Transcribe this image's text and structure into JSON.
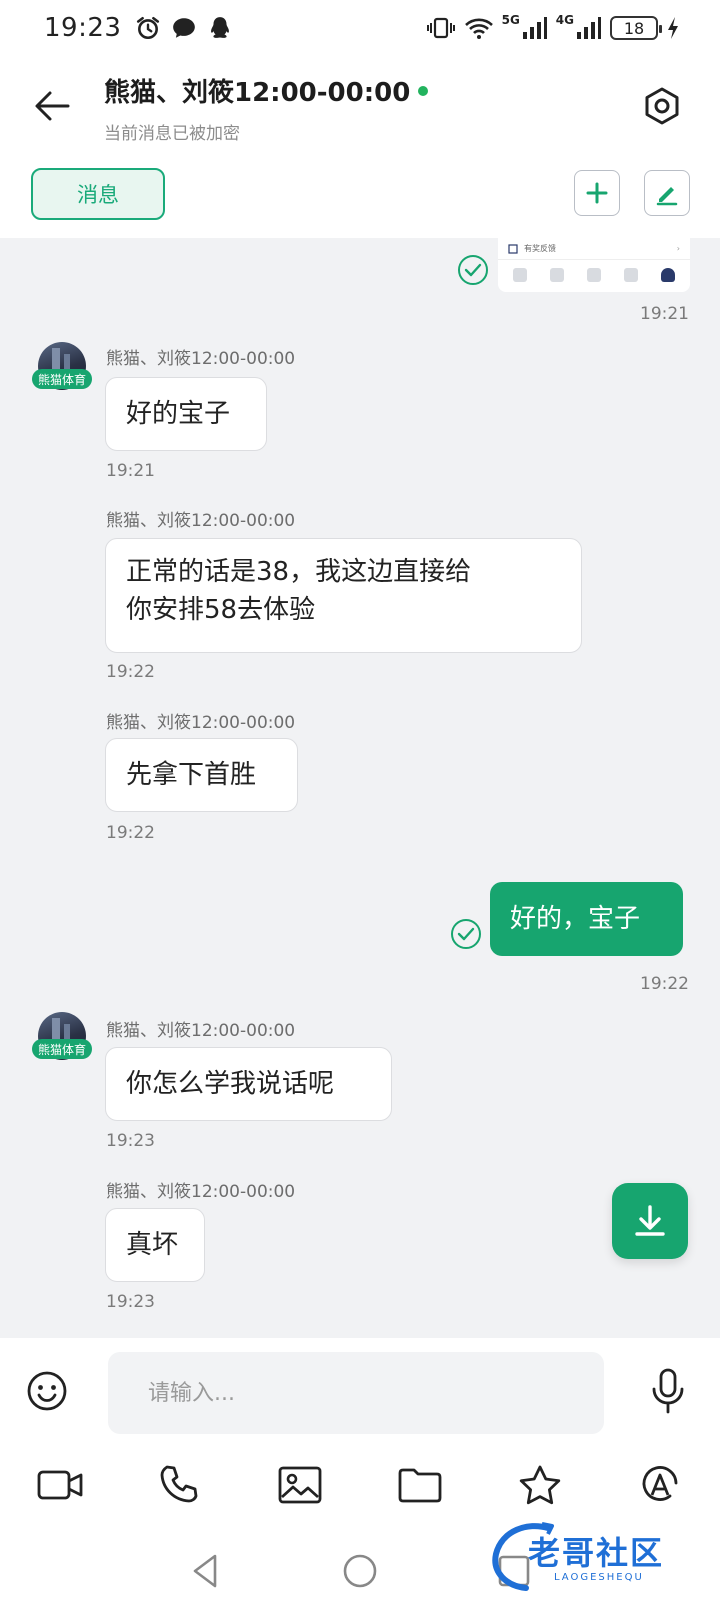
{
  "status_bar": {
    "time": "19:23",
    "network_1": "5G",
    "network_2": "4G",
    "battery": "18"
  },
  "header": {
    "title": "熊猫、刘筱12:00-00:00",
    "subtitle": "当前消息已被加密"
  },
  "tabs": {
    "messages_label": "消息"
  },
  "screenshot_preview": {
    "row_label": "有奖反馈"
  },
  "messages": [
    {
      "side": "self",
      "kind": "image",
      "time": "19:21"
    },
    {
      "side": "other",
      "sender": "熊猫、刘筱12:00-00:00",
      "avatar_tag": "熊猫体育",
      "text": "好的宝子",
      "time": "19:21"
    },
    {
      "side": "other",
      "sender": "熊猫、刘筱12:00-00:00",
      "text_line1": "正常的话是38，我这边直接给",
      "text_line2": "你安排58去体验",
      "time": "19:22"
    },
    {
      "side": "other",
      "sender": "熊猫、刘筱12:00-00:00",
      "text": "先拿下首胜",
      "time": "19:22"
    },
    {
      "side": "self",
      "text": "好的，宝子",
      "time": "19:22"
    },
    {
      "side": "other",
      "sender": "熊猫、刘筱12:00-00:00",
      "avatar_tag": "熊猫体育",
      "text": "你怎么学我说话呢",
      "time": "19:23"
    },
    {
      "side": "other",
      "sender": "熊猫、刘筱12:00-00:00",
      "text": "真坏",
      "time": "19:23"
    }
  ],
  "input": {
    "placeholder": "请输入..."
  },
  "watermark": {
    "text": "老哥社区",
    "sub": "LAOGESHEQU"
  },
  "colors": {
    "accent": "#17a56f",
    "online": "#22b35e",
    "background": "#f1f2f4"
  }
}
